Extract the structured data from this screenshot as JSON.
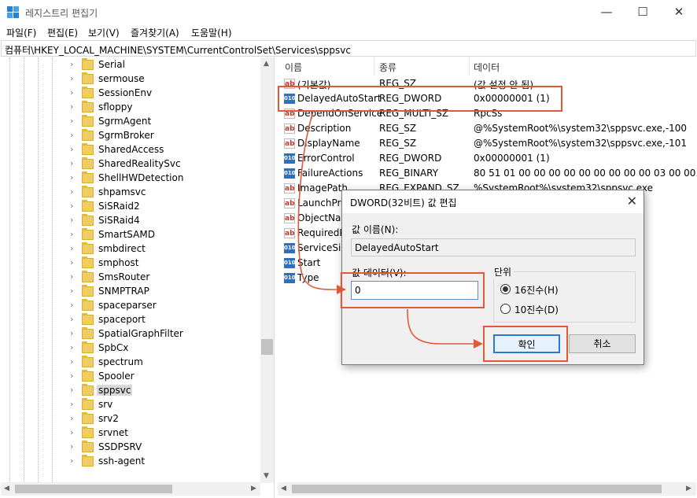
{
  "window": {
    "title": "레지스트리 편집기",
    "minimize": "—",
    "maximize": "☐",
    "close": "✕"
  },
  "menu": [
    "파일(F)",
    "편집(E)",
    "보기(V)",
    "즐겨찾기(A)",
    "도움말(H)"
  ],
  "address": "컴퓨터\\HKEY_LOCAL_MACHINE\\SYSTEM\\CurrentControlSet\\Services\\sppsvc",
  "tree": {
    "selected": "sppsvc",
    "items": [
      "Serial",
      "sermouse",
      "SessionEnv",
      "sfloppy",
      "SgrmAgent",
      "SgrmBroker",
      "SharedAccess",
      "SharedRealitySvc",
      "ShellHWDetection",
      "shpamsvc",
      "SiSRaid2",
      "SiSRaid4",
      "SmartSAMD",
      "smbdirect",
      "smphost",
      "SmsRouter",
      "SNMPTRAP",
      "spaceparser",
      "spaceport",
      "SpatialGraphFilter",
      "SpbCx",
      "spectrum",
      "Spooler",
      "sppsvc",
      "srv",
      "srv2",
      "srvnet",
      "SSDPSRV",
      "ssh-agent"
    ]
  },
  "values_list": {
    "headers": {
      "name": "이름",
      "type": "종류",
      "data": "데이터"
    },
    "rows": [
      {
        "icon": "string-value-icon",
        "name": "(기본값)",
        "type": "REG_SZ",
        "data": "(값 설정 안 됨)"
      },
      {
        "icon": "binary-value-icon",
        "name": "DelayedAutoStart",
        "type": "REG_DWORD",
        "data": "0x00000001 (1)"
      },
      {
        "icon": "string-value-icon",
        "name": "DependOnService",
        "type": "REG_MULTI_SZ",
        "data": "RpcSs"
      },
      {
        "icon": "string-value-icon",
        "name": "Description",
        "type": "REG_SZ",
        "data": "@%SystemRoot%\\system32\\sppsvc.exe,-100"
      },
      {
        "icon": "string-value-icon",
        "name": "DisplayName",
        "type": "REG_SZ",
        "data": "@%SystemRoot%\\system32\\sppsvc.exe,-101"
      },
      {
        "icon": "binary-value-icon",
        "name": "ErrorControl",
        "type": "REG_DWORD",
        "data": "0x00000001 (1)"
      },
      {
        "icon": "binary-value-icon",
        "name": "FailureActions",
        "type": "REG_BINARY",
        "data": "80 51 01 00 00 00 00 00 00 00 00 00 03 00 00..."
      },
      {
        "icon": "string-value-icon",
        "name": "ImagePath",
        "type": "REG_EXPAND_SZ",
        "data": "%SystemRoot%\\system32\\sppsvc.exe"
      },
      {
        "icon": "string-value-icon",
        "name": "LaunchProtected",
        "type": "",
        "data": ""
      },
      {
        "icon": "string-value-icon",
        "name": "ObjectName",
        "type": "",
        "data": ""
      },
      {
        "icon": "string-value-icon",
        "name": "RequiredPrivileges",
        "type": "",
        "data": "e SeCrea..."
      },
      {
        "icon": "binary-value-icon",
        "name": "ServiceSidType",
        "type": "",
        "data": ""
      },
      {
        "icon": "binary-value-icon",
        "name": "Start",
        "type": "",
        "data": ""
      },
      {
        "icon": "binary-value-icon",
        "name": "Type",
        "type": "",
        "data": ""
      }
    ]
  },
  "dialog": {
    "title": "DWORD(32비트) 값 편집",
    "name_label": "값 이름(N):",
    "name_value": "DelayedAutoStart",
    "data_label": "값 데이터(V):",
    "data_value": "0",
    "base_label": "단위",
    "base_hex": "16진수(H)",
    "base_dec": "10진수(D)",
    "base_selected": "hex",
    "ok": "확인",
    "cancel": "취소",
    "close": "✕"
  },
  "annotation_color": "#e05a3a"
}
